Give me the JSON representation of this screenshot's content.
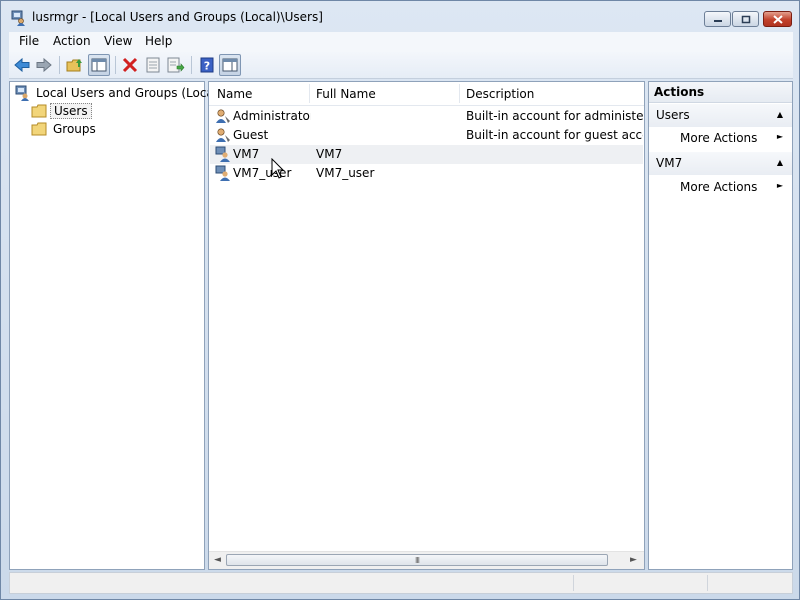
{
  "window": {
    "title": "lusrmgr - [Local Users and Groups (Local)\\Users]"
  },
  "menu": [
    "File",
    "Action",
    "View",
    "Help"
  ],
  "toolbar": {
    "buttons": [
      "back-icon",
      "forward-icon",
      "up-folder-icon",
      "show-hide-tree-icon",
      "delete-icon",
      "properties-icon",
      "export-list-icon",
      "help-icon",
      "show-hide-action-pane-icon"
    ]
  },
  "tree": {
    "root": "Local Users and Groups (Local)",
    "children": [
      "Users",
      "Groups"
    ],
    "selected": "Users"
  },
  "list": {
    "columns": [
      "Name",
      "Full Name",
      "Description"
    ],
    "rows": [
      {
        "name": "Administrator",
        "full_name": "",
        "description": "Built-in account for administering"
      },
      {
        "name": "Guest",
        "full_name": "",
        "description": "Built-in account for guest access t"
      },
      {
        "name": "VM7",
        "full_name": "VM7",
        "description": ""
      },
      {
        "name": "VM7_user",
        "full_name": "VM7_user",
        "description": ""
      }
    ],
    "scroll_thumb_grip": "III"
  },
  "actions": {
    "title": "Actions",
    "sections": [
      {
        "label": "Users",
        "item": "More Actions"
      },
      {
        "label": "VM7",
        "item": "More Actions"
      }
    ]
  },
  "colors": {
    "titlebar": "#dde7f3",
    "close_button": "#c2412b",
    "border": "#8fa2ba"
  }
}
